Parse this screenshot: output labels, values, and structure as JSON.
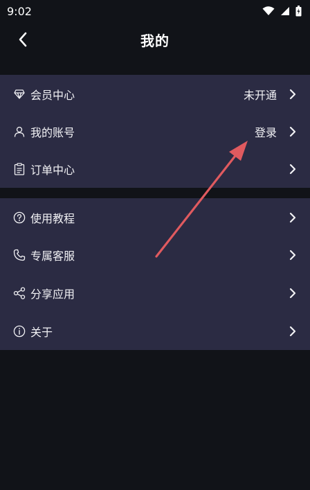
{
  "status_bar": {
    "time": "9:02"
  },
  "header": {
    "title": "我的"
  },
  "section1": [
    {
      "label": "会员中心",
      "value": "未开通",
      "icon": "diamond-icon"
    },
    {
      "label": "我的账号",
      "value": "登录",
      "icon": "user-icon"
    },
    {
      "label": "订单中心",
      "value": "",
      "icon": "clipboard-icon"
    }
  ],
  "section2": [
    {
      "label": "使用教程",
      "icon": "help-circle-icon"
    },
    {
      "label": "专属客服",
      "icon": "phone-icon"
    },
    {
      "label": "分享应用",
      "icon": "share-icon"
    },
    {
      "label": "关于",
      "icon": "info-icon"
    }
  ],
  "colors": {
    "background": "#111318",
    "card": "#2b2b43",
    "text": "#f2f2f5",
    "annotation_arrow": "#e05a5f"
  }
}
